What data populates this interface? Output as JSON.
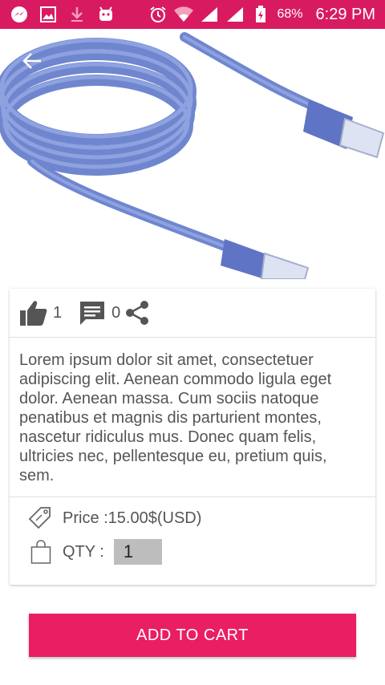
{
  "status_bar": {
    "battery_percent": "68%",
    "time": "6:29 PM",
    "bg_color": "#d81b60"
  },
  "product": {
    "likes": "1",
    "comments": "0",
    "description": "Lorem ipsum dolor sit amet, consectetuer adipiscing elit. Aenean commodo ligula eget dolor. Aenean massa. Cum sociis natoque penatibus et magnis dis parturient montes, nascetur ridiculus mus. Donec quam felis, ultricies nec, pellentesque eu, pretium quis, sem.",
    "price_label": "Price :15.00$(USD)",
    "qty_label": "QTY :",
    "qty_value": "1"
  },
  "actions": {
    "add_to_cart": "ADD TO CART",
    "accent_color": "#e91e63"
  },
  "icons": [
    "messenger-icon",
    "gallery-icon",
    "download-icon",
    "android-icon",
    "alarm-icon",
    "wifi-icon",
    "signal-icon",
    "battery-icon",
    "back-arrow-icon",
    "thumbs-up-icon",
    "comment-icon",
    "share-icon",
    "price-tag-icon",
    "shopping-bag-icon"
  ]
}
